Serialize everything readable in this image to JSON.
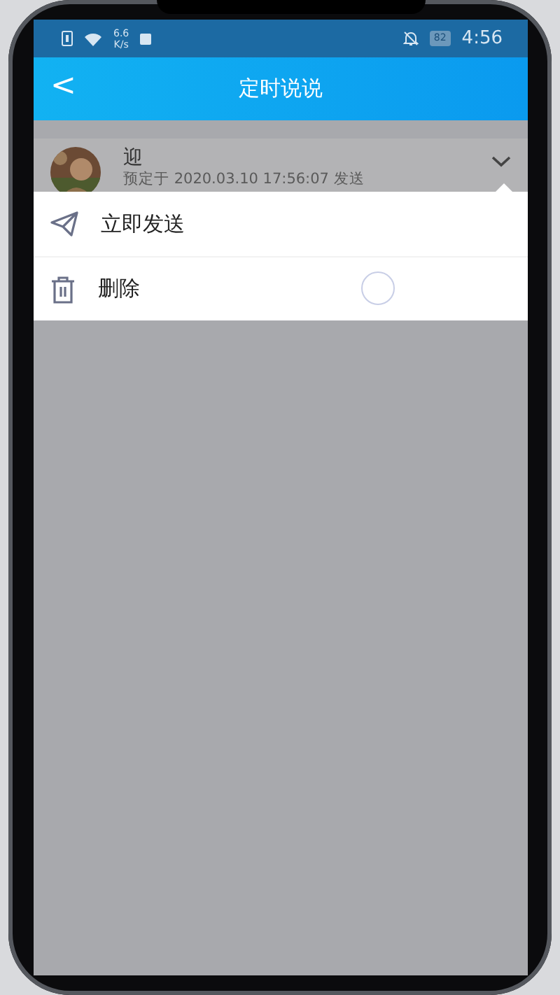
{
  "status_bar": {
    "net_speed": "6.6",
    "net_unit": "K/s",
    "battery": "82",
    "time": "4:56"
  },
  "header": {
    "back": "<",
    "title": "定时说说"
  },
  "post": {
    "author": "迎",
    "schedule": "预定于 2020.03.10 17:56:07 发送"
  },
  "menu": [
    {
      "kind": "send",
      "label": "立即发送"
    },
    {
      "kind": "delete",
      "label": "删除"
    }
  ],
  "loading": true
}
